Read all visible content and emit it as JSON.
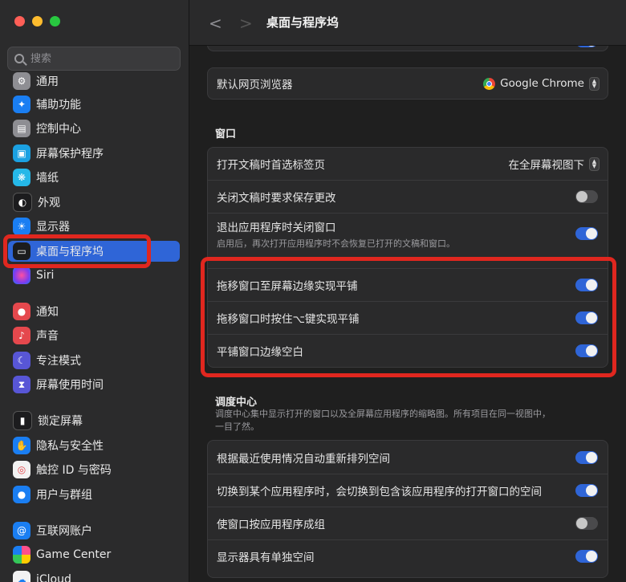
{
  "window": {
    "title": "桌面与程序坞"
  },
  "search": {
    "placeholder": "搜索"
  },
  "sidebar": {
    "items": [
      {
        "label": "通用",
        "icon": "gear-icon",
        "color": "#8e8e93",
        "glyph": "⚙"
      },
      {
        "label": "辅助功能",
        "icon": "accessibility-icon",
        "color": "#1a7ef2",
        "glyph": "♿"
      },
      {
        "label": "控制中心",
        "icon": "control-center-icon",
        "color": "#8e8e93",
        "glyph": "▤"
      },
      {
        "label": "屏幕保护程序",
        "icon": "screensaver-icon",
        "color": "#1ba1e2",
        "glyph": "▣"
      },
      {
        "label": "墙纸",
        "icon": "wallpaper-icon",
        "color": "#25b8e8",
        "glyph": "❋"
      },
      {
        "label": "外观",
        "icon": "appearance-icon",
        "color": "#1c1c1e",
        "glyph": "◐"
      },
      {
        "label": "显示器",
        "icon": "display-icon",
        "color": "#1a7ef2",
        "glyph": "☀"
      },
      {
        "label": "桌面与程序坞",
        "icon": "desktop-dock-icon",
        "color": "#1c1c1e",
        "glyph": "▭"
      },
      {
        "label": "Siri",
        "icon": "siri-icon",
        "color": "#7d3cf0",
        "glyph": "●"
      },
      {
        "label": "通知",
        "icon": "notifications-icon",
        "color": "#e5484d",
        "glyph": "🔔"
      },
      {
        "label": "声音",
        "icon": "sound-icon",
        "color": "#e5484d",
        "glyph": "♪"
      },
      {
        "label": "专注模式",
        "icon": "focus-icon",
        "color": "#5856d6",
        "glyph": "☾"
      },
      {
        "label": "屏幕使用时间",
        "icon": "screen-time-icon",
        "color": "#5856d6",
        "glyph": "⧗"
      },
      {
        "label": "锁定屏幕",
        "icon": "lock-screen-icon",
        "color": "#1c1c1e",
        "glyph": "🔒"
      },
      {
        "label": "隐私与安全性",
        "icon": "privacy-hand-icon",
        "color": "#1a7ef2",
        "glyph": "✋"
      },
      {
        "label": "触控 ID 与密码",
        "icon": "touch-id-icon",
        "color": "#f2f2f2",
        "glyph": "◎"
      },
      {
        "label": "用户与群组",
        "icon": "users-icon",
        "color": "#1a7ef2",
        "glyph": "👥"
      },
      {
        "label": "互联网账户",
        "icon": "internet-accounts-icon",
        "color": "#1a7ef2",
        "glyph": "@"
      },
      {
        "label": "Game Center",
        "icon": "game-center-icon",
        "color": "#f2f2f2",
        "glyph": "●"
      },
      {
        "label": "iCloud",
        "icon": "icloud-icon",
        "color": "#f2f2f2",
        "glyph": "☁"
      }
    ]
  },
  "main": {
    "browser_row": {
      "label": "默认网页浏览器",
      "value": "Google Chrome"
    },
    "windows_section": {
      "heading": "窗口",
      "rows": [
        {
          "label": "打开文稿时首选标签页",
          "value": "在全屏幕视图下"
        },
        {
          "label": "关闭文稿时要求保存更改",
          "on": false
        },
        {
          "label": "退出应用程序时关闭窗口",
          "sub": "启用后，再次打开应用程序时不会恢复已打开的文稿和窗口。",
          "on": true
        },
        {
          "label": "拖移窗口至屏幕边缘实现平铺",
          "on": true
        },
        {
          "label": "拖移窗口时按住⌥键实现平铺",
          "on": true
        },
        {
          "label": "平铺窗口边缘空白",
          "on": true
        }
      ]
    },
    "mission_control": {
      "heading": "调度中心",
      "desc": "调度中心集中显示打开的窗口以及全屏幕应用程序的缩略图。所有项目在同一视图中，一目了然。",
      "rows": [
        {
          "label": "根据最近使用情况自动重新排列空间",
          "on": true
        },
        {
          "label": "切换到某个应用程序时，会切换到包含该应用程序的打开窗口的空间",
          "on": true
        },
        {
          "label": "使窗口按应用程序成组",
          "on": false
        },
        {
          "label": "显示器具有单独空间",
          "on": true
        }
      ]
    }
  },
  "colors": {
    "accent": "#2f65d7",
    "highlight": "#e0271f"
  }
}
